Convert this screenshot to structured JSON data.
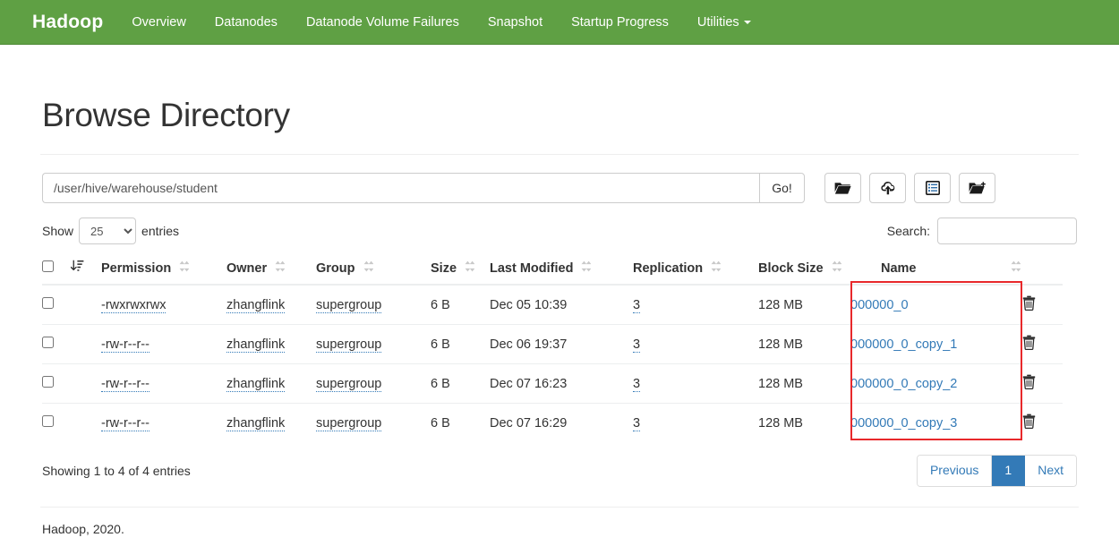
{
  "navbar": {
    "brand": "Hadoop",
    "items": [
      {
        "label": "Overview",
        "icon": ""
      },
      {
        "label": "Datanodes",
        "icon": ""
      },
      {
        "label": "Datanode Volume Failures",
        "icon": ""
      },
      {
        "label": "Snapshot",
        "icon": ""
      },
      {
        "label": "Startup Progress",
        "icon": ""
      },
      {
        "label": "Utilities",
        "icon": "caret-down-icon"
      }
    ],
    "background_color": "#5fa044"
  },
  "page": {
    "title": "Browse Directory"
  },
  "path_bar": {
    "value": "/user/hive/warehouse/student",
    "placeholder": "Enter path",
    "go_label": "Go!",
    "tools": [
      {
        "name": "folder-open-icon",
        "title": "Browse"
      },
      {
        "name": "cloud-upload-icon",
        "title": "Upload files"
      },
      {
        "name": "list-alt-icon",
        "title": "Cut and paste"
      },
      {
        "name": "folder-plus-icon",
        "title": "Create directory"
      }
    ]
  },
  "table_controls": {
    "show_label": "Show",
    "entries_label": "entries",
    "page_length": "25",
    "page_length_options": [
      "25",
      "50",
      "100",
      "-1"
    ],
    "search_label": "Search:",
    "search_value": "",
    "search_placeholder": ""
  },
  "table": {
    "columns": [
      {
        "key": "check",
        "label": "",
        "sort": "none"
      },
      {
        "key": "sorticon",
        "label": "",
        "sort": "desc-active"
      },
      {
        "key": "perm",
        "label": "Permission",
        "sort": "both"
      },
      {
        "key": "owner",
        "label": "Owner",
        "sort": "both"
      },
      {
        "key": "group",
        "label": "Group",
        "sort": "both"
      },
      {
        "key": "size",
        "label": "Size",
        "sort": "both"
      },
      {
        "key": "mod",
        "label": "Last Modified",
        "sort": "both"
      },
      {
        "key": "repl",
        "label": "Replication",
        "sort": "both"
      },
      {
        "key": "block",
        "label": "Block Size",
        "sort": "both"
      },
      {
        "key": "name",
        "label": "Name",
        "sort": "both"
      },
      {
        "key": "trash",
        "label": "",
        "sort": "none"
      }
    ],
    "rows": [
      {
        "permission": "-rwxrwxrwx",
        "owner": "zhangflink",
        "group": "supergroup",
        "size": "6 B",
        "last_modified": "Dec 05 10:39",
        "replication": "3",
        "block_size": "128 MB",
        "name": "000000_0",
        "delete_icon": "trash-icon"
      },
      {
        "permission": "-rw-r--r--",
        "owner": "zhangflink",
        "group": "supergroup",
        "size": "6 B",
        "last_modified": "Dec 06 19:37",
        "replication": "3",
        "block_size": "128 MB",
        "name": "000000_0_copy_1",
        "delete_icon": "trash-icon"
      },
      {
        "permission": "-rw-r--r--",
        "owner": "zhangflink",
        "group": "supergroup",
        "size": "6 B",
        "last_modified": "Dec 07 16:23",
        "replication": "3",
        "block_size": "128 MB",
        "name": "000000_0_copy_2",
        "delete_icon": "trash-icon"
      },
      {
        "permission": "-rw-r--r--",
        "owner": "zhangflink",
        "group": "supergroup",
        "size": "6 B",
        "last_modified": "Dec 07 16:29",
        "replication": "3",
        "block_size": "128 MB",
        "name": "000000_0_copy_3",
        "delete_icon": "trash-icon"
      }
    ]
  },
  "pagination": {
    "info": "Showing 1 to 4 of 4 entries",
    "previous_label": "Previous",
    "next_label": "Next",
    "pages": [
      "1"
    ],
    "active_page": "1",
    "active_color": "#337ab7"
  },
  "footer": {
    "text": "Hadoop, 2020."
  },
  "annotation": {
    "color": "#e8282b",
    "target_column": "Name"
  }
}
